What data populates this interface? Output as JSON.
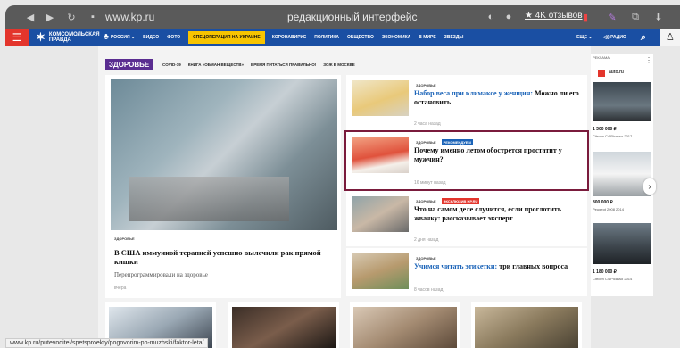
{
  "browser": {
    "url": "www.kp.ru",
    "tab_title": "редакционный интерфейс",
    "reviews_label": "★ 4K отзывов"
  },
  "header": {
    "logo_line1": "КОМСОМОЛЬСКАЯ",
    "logo_line2": "ПРАВДА",
    "nav_items": [
      "РОССИЯ ⌄",
      "ВИДЕО",
      "ФОТО"
    ],
    "special_item": "СПЕЦОПЕРАЦИЯ НА УКРАИНЕ",
    "nav_items_2": [
      "КОРОНАВИРУС",
      "ПОЛИТИКА",
      "ОБЩЕСТВО",
      "ЭКОНОМИКА",
      "В МИРЕ",
      "ЗВЕЗДЫ"
    ],
    "right_items": [
      "ЕЩЕ ⌄",
      "◁)) РАДИО"
    ]
  },
  "section": {
    "tag": "ЗДОРОВЬЕ",
    "subnav": [
      "COVID-19",
      "КНИГА «ОБМАН ВЕЩЕСТВ»",
      "ВРЕМЯ ПИТАТЬСЯ ПРАВИЛЬНО!",
      "ЗОЖ В МОСКВЕ"
    ]
  },
  "main_article": {
    "tag": "ЗДОРОВЬЕ",
    "title": "В США иммунной терапией успешно вылечили рак прямой кишки",
    "subtitle": "Перепрограммировали на здоровье",
    "time": "вчера"
  },
  "news": [
    {
      "tags": [
        "ЗДОРОВЬЕ"
      ],
      "title_blue": "Набор веса при климаксе у женщин:",
      "title": " Можно ли его остановить",
      "time": "2 часа назад"
    },
    {
      "tags": [
        "ЗДОРОВЬЕ",
        "РЕКОМЕНДУЕМ"
      ],
      "title_blue": "",
      "title": "Почему именно летом обострется простатит у мужчин?",
      "time": "16 минут назад"
    },
    {
      "tags": [
        "ЗДОРОВЬЕ",
        "ЭКСКЛЮЗИВ KP.RU"
      ],
      "title_blue": "",
      "title": "Что на самом деле случится, если проглотить жвачку: рассказывает эксперт",
      "time": "2 дня назад"
    },
    {
      "tags": [
        "ЗДОРОВЬЕ"
      ],
      "title_blue": "Учимся читать этикетки:",
      "title": " три главных вопроса",
      "time": "8 часов назад"
    }
  ],
  "sidebar_ad": {
    "header": "РЕКЛАМА",
    "logo": "auto.ru",
    "cars": [
      {
        "price": "1 300 000 ₽",
        "model": "Citroen C4 Picasso 2017"
      },
      {
        "price": "800 000 ₽",
        "model": "Peugeot 2008 2014"
      },
      {
        "price": "1 180 000 ₽",
        "model": "Citroen C4 Picasso 2014"
      }
    ]
  },
  "status_url": "www.kp.ru/putevoditel/spetsproekty/pogovorim-po-muzhski/faktor-leta/",
  "colors": {
    "header_blue": "#1a4fa3",
    "accent_red": "#e3352c",
    "section_purple": "#5a2d91",
    "special_yellow": "#f7c400",
    "highlight_border": "#7a1b3c"
  }
}
